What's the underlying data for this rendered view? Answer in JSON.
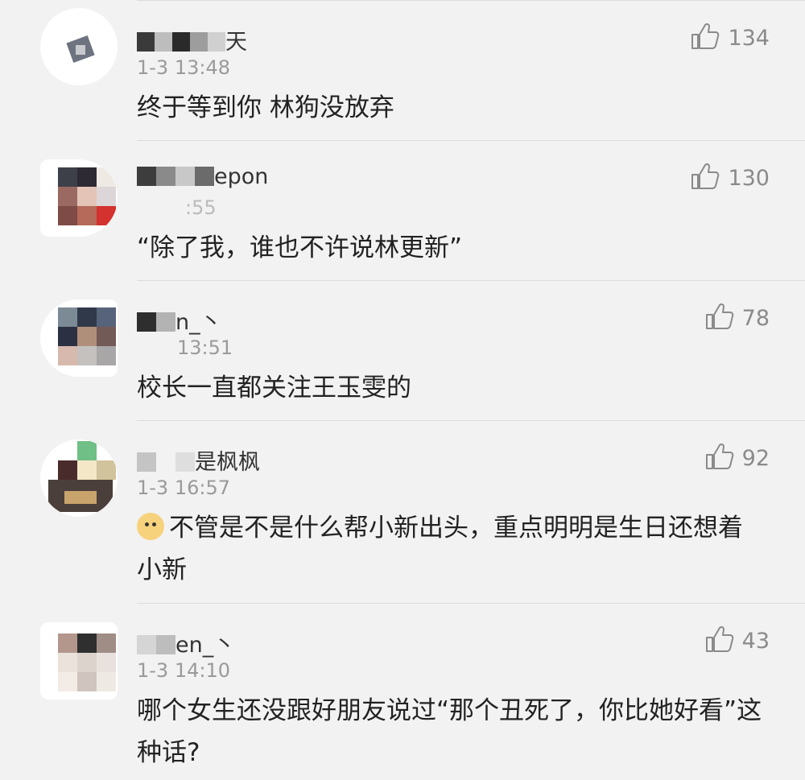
{
  "comments": [
    {
      "username": "天",
      "time": "1-3 13:48",
      "text": "终于等到你 林狗没放弃",
      "likes": "134"
    },
    {
      "username": "epon",
      "time": ":55",
      "text": "“除了我，谁也不许说林更新”",
      "likes": "130"
    },
    {
      "username": "n_丶",
      "time": "13:51",
      "text": "校长一直都关注王玉雯的",
      "likes": "78"
    },
    {
      "username": "是枫枫",
      "time": "1-3 16:57",
      "emoji": "doge-emoji",
      "text": "不管是不是什么帮小新出头，重点明明是生日还想着小新",
      "likes": "92"
    },
    {
      "username": "en_丶",
      "time": "1-3 14:10",
      "text": "哪个女生还没跟好朋友说过“那个丑死了，你比她好看”这种话?",
      "likes": "43"
    }
  ],
  "icons": {
    "like": "thumbs-up-icon"
  }
}
